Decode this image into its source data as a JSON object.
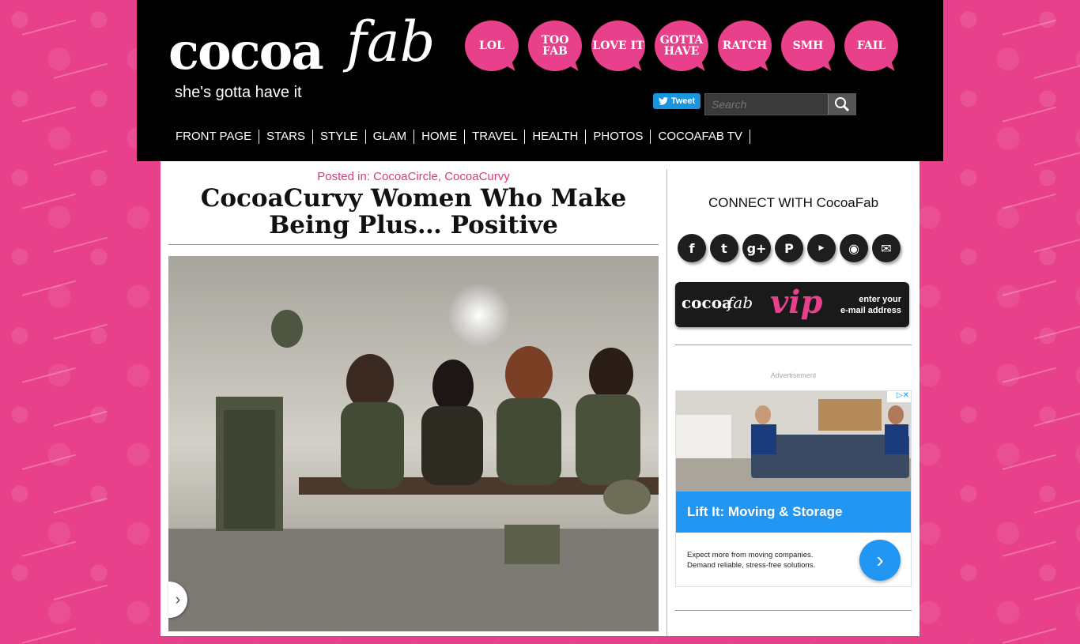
{
  "logo": {
    "word": "cocoa",
    "script": "fab",
    "tagline": "she's gotta have it"
  },
  "reactions": [
    "LOL",
    "TOO FAB",
    "LOVE IT",
    "GOTTA HAVE",
    "RATCH",
    "SMH",
    "FAIL"
  ],
  "tweet_label": "Tweet",
  "search": {
    "placeholder": "Search"
  },
  "nav": [
    "FRONT PAGE",
    "STARS",
    "STYLE",
    "GLAM",
    "HOME",
    "TRAVEL",
    "HEALTH",
    "PHOTOS",
    "COCOAFAB TV"
  ],
  "article": {
    "posted_label": "Posted in:",
    "categories": [
      "CocoaCircle",
      "CocoaCurvy"
    ],
    "title": "CocoaCurvy Women Who Make Being Plus… Positive"
  },
  "sidebar": {
    "connect_title": "CONNECT WITH CocoaFab",
    "social_icons": [
      "facebook-icon",
      "twitter-icon",
      "google-plus-icon",
      "pinterest-icon",
      "youtube-icon",
      "rss-icon",
      "email-icon"
    ],
    "vip": {
      "word": "cocoa",
      "script": "fab",
      "vip": "vip",
      "cta_line1": "enter your",
      "cta_line2": "e-mail address"
    },
    "ad": {
      "label": "Advertisement",
      "headline": "Lift It: Moving & Storage",
      "body_line1": "Expect more from moving companies.",
      "body_line2": "Demand reliable, stress-free solutions."
    }
  },
  "colors": {
    "brand_pink": "#e8408a",
    "header_black": "#000000",
    "ad_blue": "#2196f3"
  }
}
